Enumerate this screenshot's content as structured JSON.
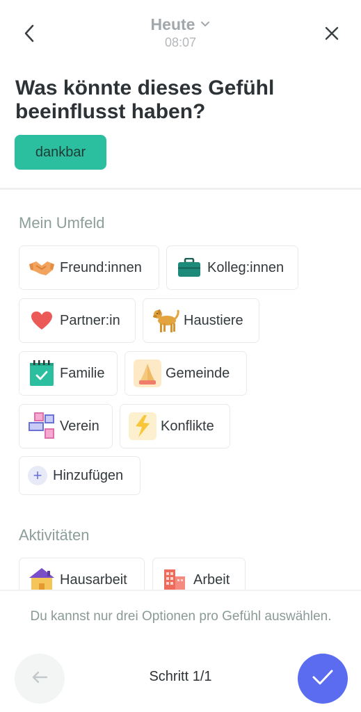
{
  "header": {
    "date_label": "Heute",
    "time": "08:07",
    "back_icon": "chevron-left-icon",
    "close_icon": "close-icon",
    "dropdown_icon": "chevron-down-icon"
  },
  "question": "Was könnte dieses Gefühl beeinflusst haben?",
  "feeling": "dankbar",
  "colors": {
    "accent_green": "#2bbf9f",
    "confirm_blue": "#5b6cf0",
    "section_gray": "#8c9e9a"
  },
  "sections": {
    "umfeld": {
      "title": "Mein Umfeld",
      "items": [
        {
          "label": "Freund:innen",
          "icon": "handshake-icon"
        },
        {
          "label": "Kolleg:innen",
          "icon": "briefcase-icon"
        },
        {
          "label": "Partner:in",
          "icon": "heart-icon"
        },
        {
          "label": "Haustiere",
          "icon": "dog-icon"
        },
        {
          "label": "Familie",
          "icon": "calendar-check-icon"
        },
        {
          "label": "Gemeinde",
          "icon": "praying-hands-icon"
        },
        {
          "label": "Verein",
          "icon": "blocks-icon"
        },
        {
          "label": "Konflikte",
          "icon": "lightning-icon"
        }
      ],
      "add_label": "Hinzufügen"
    },
    "aktivitaeten": {
      "title": "Aktivitäten",
      "items": [
        {
          "label": "Hausarbeit",
          "icon": "house-icon"
        },
        {
          "label": "Arbeit",
          "icon": "office-building-icon"
        }
      ]
    }
  },
  "footer": {
    "note": "Du kannst nur drei Optionen pro Gefühl auswählen.",
    "step": "Schritt 1/1",
    "prev_icon": "arrow-left-icon",
    "confirm_icon": "checkmark-icon"
  }
}
